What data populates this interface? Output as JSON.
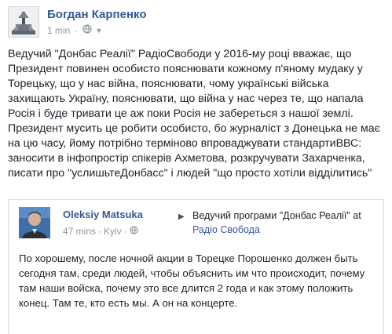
{
  "post": {
    "author": "Богдан Карпенко",
    "time": "1 min",
    "separator": "·",
    "privacy_icon": "globe-icon",
    "menu_icon": "chevron-down-icon",
    "text": "Ведучий \"Донбас Реалії\" РадіоСвободи у 2016-му році вважає, що Президент повинен особисто пояснювати кожному п'яному мудаку у Торецьку, що у нас війна, пояснювати, чому українські війська захищають Україну, пояснювати, що війна у нас через те, що напала Росія і буде тривати це аж поки Росія не забереться з нашої землі. Президент мусить це робити особисто, бо журналіст з Донецька не має на цю часу, йому потрібно терміново впроваджувати стандартиВВС: заносити в інфопростір спікерів Ахметова, розкручувати Захарченка, писати про \"услишьтеДонбасс\" і людей \"що просто хотіли відділитись\""
  },
  "shared_post": {
    "author": "Oleksiy Matsuka",
    "time": "47 mins",
    "separator": "·",
    "location": "Kyiv",
    "privacy_icon": "globe-icon",
    "context_prefix": "Ведучий програми \"Донбас Реалії\" at",
    "context_link": "Радіо Свобода",
    "text": "По хорошему, после ночной акции в Торецке Порошенко должен быть сегодня там, среди людей, чтобы объяснить им что происходит, почему там наши войска, почему это все длится 2 года и как этому положить конец. Там те, кто есть мы. А он на концерте."
  },
  "colors": {
    "link": "#365899",
    "text": "#1d2129",
    "meta": "#90949c",
    "border": "#dddfe2"
  }
}
